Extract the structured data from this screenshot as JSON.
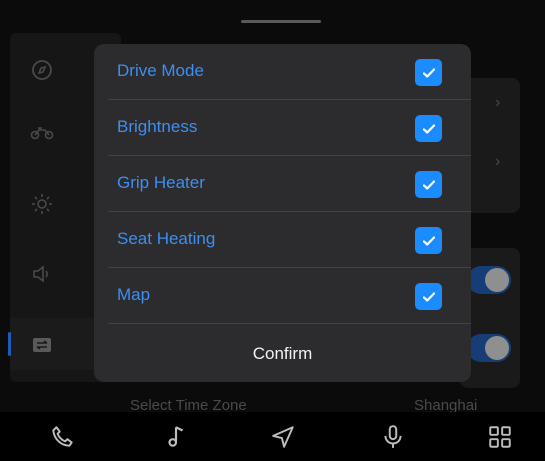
{
  "modal": {
    "options": [
      {
        "label": "Drive Mode",
        "checked": true
      },
      {
        "label": "Brightness",
        "checked": true
      },
      {
        "label": "Grip Heater",
        "checked": true
      },
      {
        "label": "Seat Heating",
        "checked": true
      },
      {
        "label": "Map",
        "checked": true
      }
    ],
    "confirm_label": "Confirm"
  },
  "background": {
    "row_label": "Select Time Zone",
    "row_value": "Shanghai"
  },
  "dock": {
    "icons": [
      "phone-icon",
      "music-note-icon",
      "navigation-icon",
      "microphone-icon",
      "app-grid-icon"
    ]
  },
  "colors": {
    "accent": "#1a8cff",
    "option_text": "#3d8ef0",
    "modal_bg": "#2c2c2e"
  }
}
